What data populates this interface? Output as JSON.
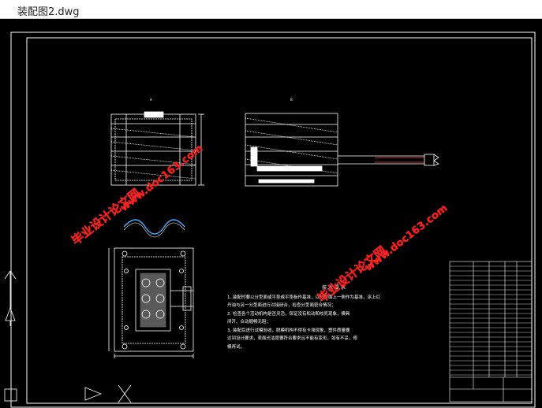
{
  "window": {
    "title": "装配图2.dwg"
  },
  "drawing": {
    "view_labels": {
      "front": "A",
      "side": "B",
      "top": "C"
    },
    "technical_requirements": {
      "heading": "技 术 要 求",
      "items": [
        "1. 装配时要以分型面或平垫或平垫板作基准，以分型面上一侧作为基准，涂上红",
        "丹油与另一分型面进行对接研合，检查分型面密合情况；",
        "2. 检查各个活动机构是否灵活，保证没有松动和咬死现象，模具",
        "闭开、合动顺畅无阻；",
        "3. 装配后进行试模验收，脱模机构不得有卡滞现象，塑件质量要",
        "达到设计要求，表面光洁度要符合要求且不能有变形，如有不妥，修",
        "模再试。"
      ]
    },
    "watermarks": {
      "brand": "毕业设计论文网",
      "url": "www.doc163.com"
    },
    "colors": {
      "line": "#ffffff",
      "accent": "#ff1a1a",
      "blue": "#4aa8ff",
      "background": "#000000"
    }
  }
}
